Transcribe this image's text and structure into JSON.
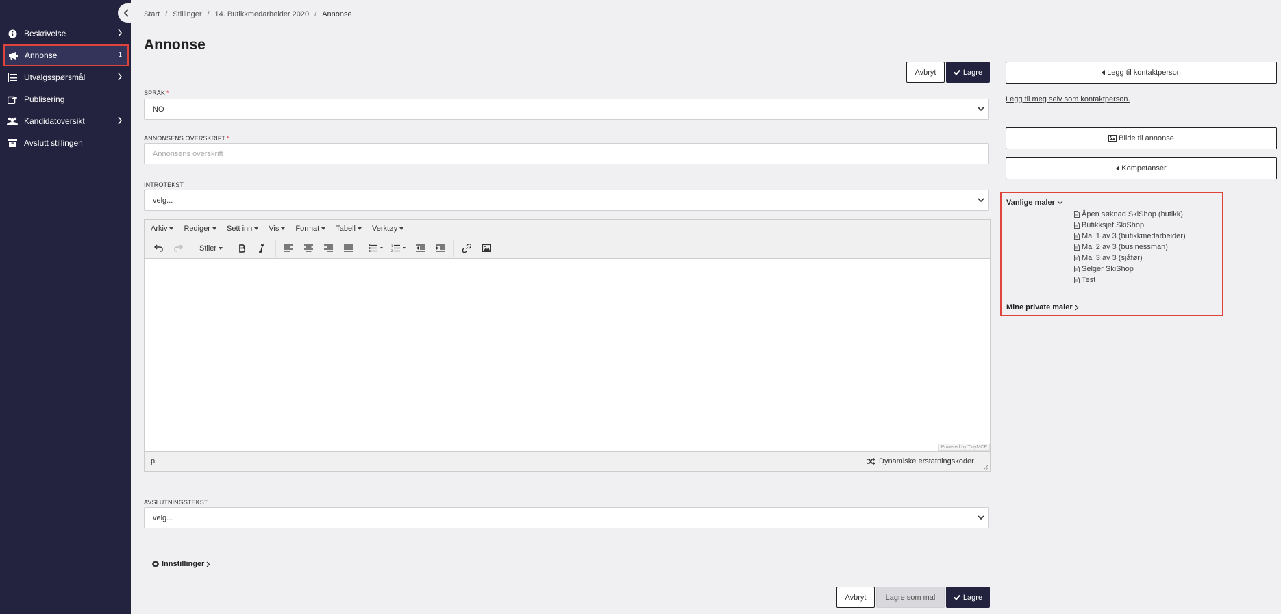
{
  "sidebar": {
    "items": [
      {
        "label": "Beskrivelse",
        "icon": "info-icon",
        "has_chevron": true
      },
      {
        "label": "Annonse",
        "icon": "megaphone-icon",
        "count": "1",
        "active": true
      },
      {
        "label": "Utvalgsspørsmål",
        "icon": "list-icon",
        "has_chevron": true
      },
      {
        "label": "Publisering",
        "icon": "share-icon"
      },
      {
        "label": "Kandidatoversikt",
        "icon": "users-icon",
        "has_chevron": true
      },
      {
        "label": "Avslutt stillingen",
        "icon": "archive-icon"
      }
    ]
  },
  "breadcrumb": [
    "Start",
    "Stillinger",
    "14. Butikkmedarbeider 2020",
    "Annonse"
  ],
  "page_title": "Annonse",
  "actions": {
    "cancel": "Avbryt",
    "save": "Lagre",
    "save_as_template": "Lagre som mal"
  },
  "form": {
    "language": {
      "label": "SPRÅK",
      "required": "*",
      "value": "NO"
    },
    "headline": {
      "label": "ANNONSENS OVERSKRIFT",
      "required": "*",
      "placeholder": "Annonsens overskrift"
    },
    "intro": {
      "label": "INTROTEKST",
      "value": "velg..."
    },
    "closing": {
      "label": "AVSLUTNINGSTEKST",
      "value": "velg..."
    }
  },
  "editor": {
    "menus": [
      "Arkiv",
      "Rediger",
      "Sett inn",
      "Vis",
      "Format",
      "Tabell",
      "Verktøy"
    ],
    "styles_label": "Stiler",
    "path": "p",
    "powered": "Powered by TinyMCE",
    "dynamic_codes": "Dynamiske erstatningskoder"
  },
  "settings_label": "Innstillinger",
  "right": {
    "add_contact": "Legg til kontaktperson",
    "add_self": "Legg til meg selv som kontaktperson.",
    "image": "Bilde til annonse",
    "competences": "Kompetanser",
    "common_templates": "Vanlige maler",
    "templates": [
      "Åpen søknad SkiShop (butikk)",
      "Butikksjef SkiShop",
      "Mal 1 av 3 (butikkmedarbeider)",
      "Mal 2 av 3 (businessman)",
      "Mal 3 av 3 (sjåfør)",
      "Selger SkiShop",
      "Test"
    ],
    "private_templates": "Mine private maler"
  }
}
